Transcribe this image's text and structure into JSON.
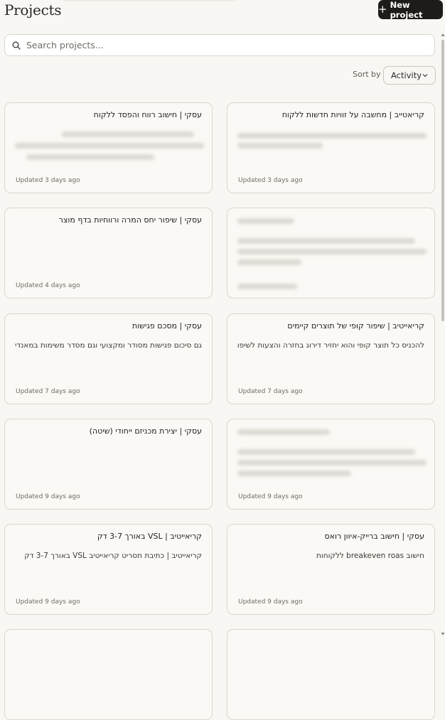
{
  "page": {
    "title": "Projects"
  },
  "header": {
    "new_project_label": "New project"
  },
  "search": {
    "placeholder": "Search projects..."
  },
  "sort": {
    "label": "Sort by",
    "value": "Activity"
  },
  "projects": [
    {
      "title": "עסקי | חישוב רווח והפסד ללקוח",
      "description": "",
      "updated": "Updated 3 days ago",
      "blurred": true
    },
    {
      "title": "קריאטייב | מחשבה על זוויות חדשות ללקוח",
      "description": "",
      "updated": "Updated 3 days ago",
      "blurred": true
    },
    {
      "title": "עסקי | שיפור יחס המרה ורווחיות בדף מוצר",
      "description": "",
      "updated": "Updated 4 days ago",
      "blurred": false
    },
    {
      "title": "",
      "description": "",
      "updated": "",
      "blurred": true
    },
    {
      "title": "עסקי | מסכם פגישות",
      "description": "גם סיכום פגישות מסודר ומקצועי וגם מסדר משימות במאנדיי",
      "updated": "Updated 7 days ago",
      "blurred": false
    },
    {
      "title": "קריאייטיב | שיפור קופי של תוצרים קיימים",
      "description": "להכניס כל תוצר קופי והוא יחזיר דירוג בחזרה והצעות לשיפור",
      "updated": "Updated 7 days ago",
      "blurred": false
    },
    {
      "title": "עסקי | יצירת מכניזם ייחודי (שיטה)",
      "description": "",
      "updated": "Updated 9 days ago",
      "blurred": false
    },
    {
      "title": "",
      "description": "",
      "updated": "Updated 9 days ago",
      "blurred": true
    },
    {
      "title": "קריאייטיב | VSL באורך 3-7 דק",
      "description": "קריאייטיב | כתיבת תסריט קריאייטיב VSL באורך 3-7 דק",
      "updated": "Updated 9 days ago",
      "blurred": false
    },
    {
      "title": "עסקי | חישוב ברייק-איוון רואס",
      "description": "חישוב breakeven roas ללקוחות",
      "updated": "Updated 9 days ago",
      "blurred": false
    }
  ]
}
